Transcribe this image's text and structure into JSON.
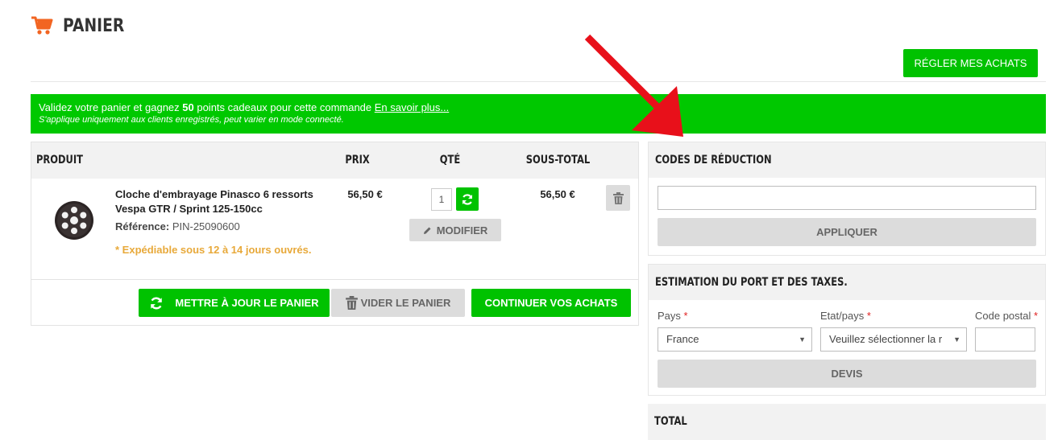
{
  "page": {
    "title": "PANIER"
  },
  "checkout_button": "RÉGLER MES ACHATS",
  "promo": {
    "line1_before": "Validez votre panier et gagnez ",
    "points": "50",
    "line1_after": " points cadeaux pour cette commande ",
    "link": "En savoir plus...",
    "line2": "S'applique uniquement aux clients enregistrés, peut varier en mode connecté."
  },
  "cart": {
    "columns": {
      "product": "PRODUIT",
      "price": "PRIX",
      "qty": "QTÉ",
      "subtotal": "SOUS-TOTAL"
    },
    "items": [
      {
        "name": "Cloche d'embrayage Pinasco 6 ressorts Vespa GTR / Sprint 125-150cc",
        "reference_label": "Référence:",
        "reference": "PIN-25090600",
        "shipping_note": "* Expédiable sous 12 à 14 jours ouvrés.",
        "price": "56,50 €",
        "qty": "1",
        "modify_label": "MODIFIER",
        "subtotal": "56,50 €"
      }
    ],
    "update_label": "METTRE À JOUR LE PANIER",
    "empty_label": "VIDER LE PANIER",
    "continue_label": "CONTINUER VOS ACHATS"
  },
  "coupon": {
    "title": "CODES DE RÉDUCTION",
    "input_value": "",
    "apply_label": "APPLIQUER"
  },
  "shipping": {
    "title": "ESTIMATION DU PORT ET DES TAXES.",
    "country_label": "Pays",
    "country_value": "France",
    "region_label": "Etat/pays",
    "region_value": "Veuillez sélectionner la r",
    "zip_label": "Code postal",
    "required_mark": "*",
    "quote_label": "DEVIS"
  },
  "totals": {
    "title": "TOTAL"
  },
  "colors": {
    "accent_green": "#00c200",
    "icon_orange": "#f26522",
    "warning_orange": "#e8a93a",
    "arrow_red": "#e8101a"
  },
  "icons": [
    "cart-icon",
    "refresh-icon",
    "pencil-icon",
    "trash-icon"
  ]
}
